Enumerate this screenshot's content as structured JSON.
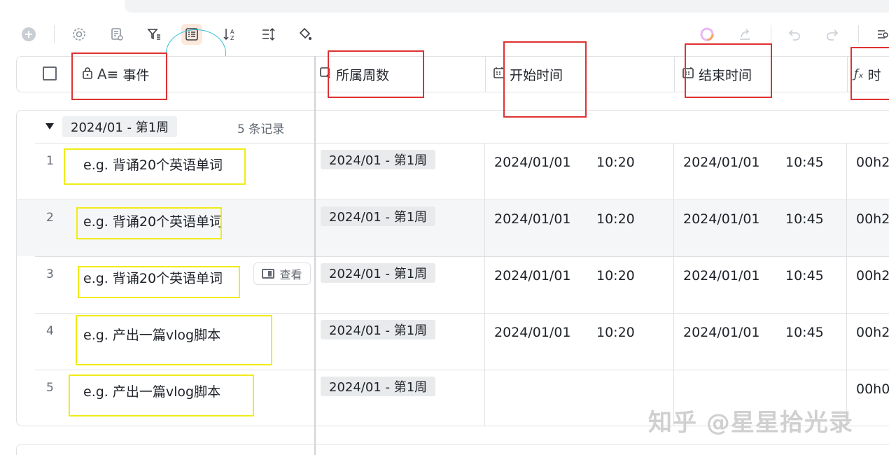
{
  "toolbar": {
    "icons": [
      "add-icon",
      "settings-icon",
      "field-settings-icon",
      "filter-icon",
      "group-icon",
      "sort-icon",
      "row-height-icon",
      "fill-color-icon",
      "ai-icon",
      "share-icon",
      "undo-icon",
      "redo-icon",
      "more-icon"
    ]
  },
  "header": {
    "col_event": "事件",
    "col_week": "所属周数",
    "col_start": "开始时间",
    "col_end": "结束时间",
    "col_duration": "时"
  },
  "group": {
    "label": "2024/01 - 第1周",
    "count": "5 条记录"
  },
  "rows": [
    {
      "num": "1",
      "event": "e.g. 背诵20个英语单词",
      "week": "2024/01 - 第1周",
      "start_date": "2024/01/01",
      "start_time": "10:20",
      "end_date": "2024/01/01",
      "end_time": "10:45",
      "duration": "00h2"
    },
    {
      "num": "2",
      "event": "e.g. 背诵20个英语单词",
      "week": "2024/01 - 第1周",
      "start_date": "2024/01/01",
      "start_time": "10:20",
      "end_date": "2024/01/01",
      "end_time": "10:45",
      "duration": "00h2"
    },
    {
      "num": "3",
      "event": "e.g. 背诵20个英语单词",
      "week": "2024/01 - 第1周",
      "start_date": "2024/01/01",
      "start_time": "10:20",
      "end_date": "2024/01/01",
      "end_time": "10:45",
      "duration": "00h2"
    },
    {
      "num": "4",
      "event": "e.g. 产出一篇vlog脚本",
      "week": "2024/01 - 第1周",
      "start_date": "2024/01/01",
      "start_time": "10:20",
      "end_date": "2024/01/01",
      "end_time": "10:45",
      "duration": "00h2"
    },
    {
      "num": "5",
      "event": "e.g. 产出一篇vlog脚本",
      "week": "2024/01 - 第1周",
      "start_date": "",
      "start_time": "",
      "end_date": "",
      "end_time": "",
      "duration": "00h0"
    }
  ],
  "view_button": "查看",
  "watermark": "知乎 @星星拾光录",
  "colors": {
    "annotation_red": "#e03131",
    "annotation_yellow": "#f0ec17",
    "annotation_circle": "#2bc0d6",
    "active_tool_bg": "#fde8dc"
  }
}
